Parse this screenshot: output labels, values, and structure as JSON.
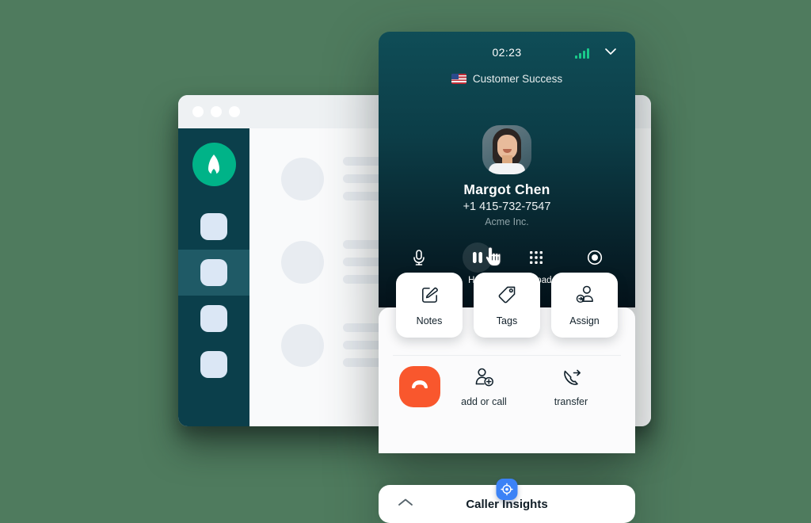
{
  "background": {
    "color": "#4f7b5e"
  },
  "browser_window": {
    "traffic_lights": [
      "close-dot",
      "minimize-dot",
      "maximize-dot"
    ],
    "sidebar": {
      "logo": "aircall-rocket-logo",
      "items": [
        {
          "name": "sidebar-item-1",
          "active": false
        },
        {
          "name": "sidebar-item-2",
          "active": true
        },
        {
          "name": "sidebar-item-3",
          "active": false
        },
        {
          "name": "sidebar-item-4",
          "active": false
        }
      ]
    },
    "content_placeholder_rows": [
      {
        "line_widths": [
          "120px",
          "140px",
          "100px"
        ]
      },
      {
        "line_widths": [
          "120px",
          "140px",
          "100px"
        ]
      },
      {
        "line_widths": [
          "120px",
          "140px",
          "100px"
        ]
      }
    ]
  },
  "phone": {
    "topbar": {
      "timer": "02:23",
      "signal_icon": "signal-bars-icon",
      "signal_bars": 4,
      "collapse_icon": "chevron-down-icon"
    },
    "queue": {
      "flag_icon": "us-flag-icon",
      "label": "Customer Success"
    },
    "contact": {
      "avatar": "contact-avatar-photo",
      "name": "Margot Chen",
      "number": "+1 415-732-7547",
      "company": "Acme Inc."
    },
    "primary_controls": [
      {
        "label": "Mute",
        "icon": "microphone-icon",
        "active": false
      },
      {
        "label": "Hold",
        "icon": "pause-icon",
        "active": true
      },
      {
        "label": "Keypad",
        "icon": "keypad-grid-icon",
        "active": false
      },
      {
        "label": "Recording",
        "icon": "record-circle-icon",
        "active": false
      }
    ],
    "action_cards": [
      {
        "label": "Notes",
        "icon": "note-pencil-icon"
      },
      {
        "label": "Tags",
        "icon": "tag-icon"
      },
      {
        "label": "Assign",
        "icon": "assign-user-icon"
      }
    ],
    "bottom_actions": {
      "hangup": {
        "label": "",
        "icon": "hangup-phone-icon",
        "color": "#f9572d"
      },
      "items": [
        {
          "label": "add or call",
          "icon": "add-user-icon"
        },
        {
          "label": "transfer",
          "icon": "transfer-call-icon"
        }
      ]
    },
    "insights": {
      "badge_icon": "caller-insights-badge-icon",
      "badge_color": "#3b82f6",
      "expand_icon": "chevron-up-icon",
      "title": "Caller Insights"
    }
  },
  "cursor": {
    "icon": "pointing-hand-cursor"
  },
  "colors": {
    "accent_green": "#00b388",
    "sidebar_dark": "#0b3f4b",
    "panel_gradient_top": "#0f4d57",
    "panel_gradient_bottom": "#04121a",
    "hangup_orange": "#f9572d",
    "badge_blue": "#3b82f6"
  }
}
